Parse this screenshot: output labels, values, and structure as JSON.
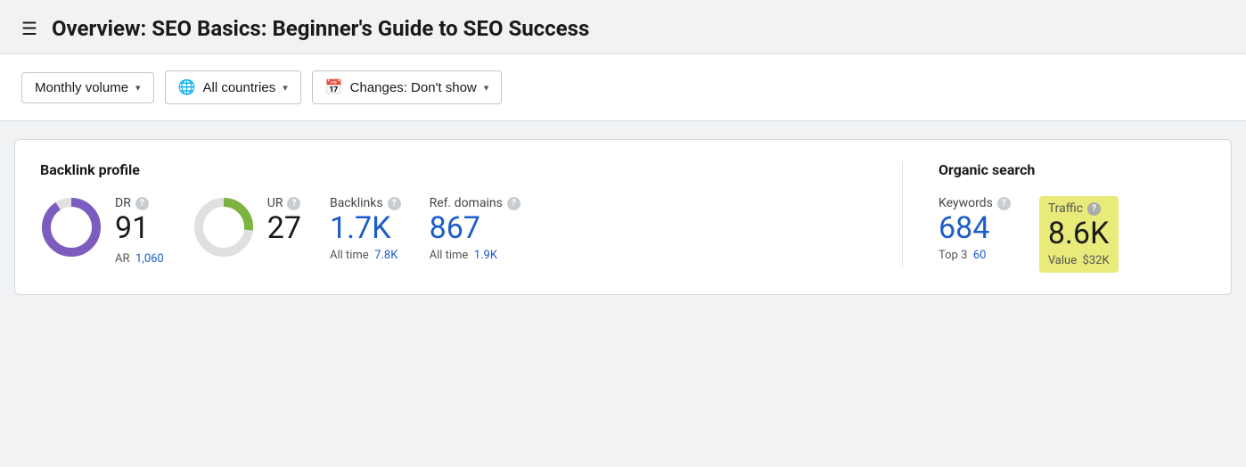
{
  "header": {
    "title": "Overview: SEO Basics: Beginner's Guide to SEO Success"
  },
  "toolbar": {
    "monthly_volume_label": "Monthly volume",
    "all_countries_label": "All countries",
    "changes_label": "Changes: Don't show"
  },
  "backlink_profile": {
    "section_title": "Backlink profile",
    "dr": {
      "label": "DR",
      "value": "91",
      "ar_label": "AR",
      "ar_value": "1,060"
    },
    "ur": {
      "label": "UR",
      "value": "27"
    },
    "backlinks": {
      "label": "Backlinks",
      "value": "1.7K",
      "sub_label": "All time",
      "sub_value": "7.8K"
    },
    "ref_domains": {
      "label": "Ref. domains",
      "value": "867",
      "sub_label": "All time",
      "sub_value": "1.9K"
    }
  },
  "organic_search": {
    "section_title": "Organic search",
    "keywords": {
      "label": "Keywords",
      "value": "684",
      "sub_label": "Top 3",
      "sub_value": "60"
    },
    "traffic": {
      "label": "Traffic",
      "value": "8.6K",
      "sub_label": "Value",
      "sub_value": "$32K"
    }
  },
  "icons": {
    "hamburger": "☰",
    "chevron_down": "▾",
    "globe": "⊕",
    "calendar": "▦",
    "help": "?"
  }
}
